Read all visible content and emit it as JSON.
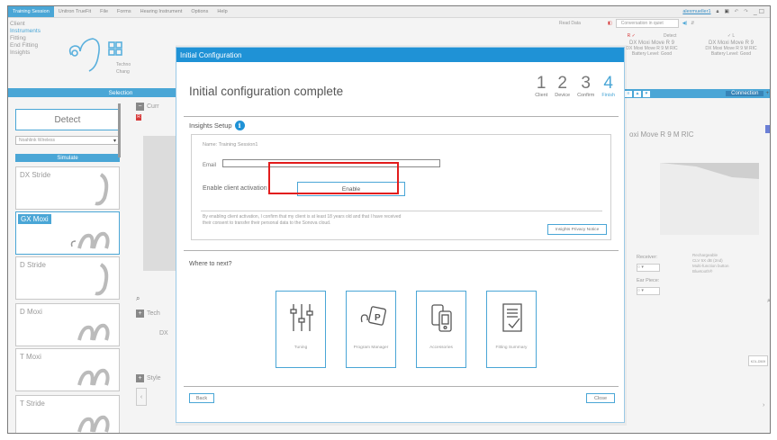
{
  "menubar": {
    "session": "Training Session",
    "items": [
      "Unitron TrueFit",
      "File",
      "Forms",
      "Hearing Instrument",
      "Options",
      "Help"
    ],
    "user": "alexmueller1",
    "win_controls": "_ ☐"
  },
  "leftnav": {
    "items": [
      "Client",
      "Instruments",
      "Fitting",
      "End Fitting",
      "Insights"
    ]
  },
  "workflow": {
    "label_1": "Techno",
    "label_2": "Chang"
  },
  "selection_label": "Selection",
  "left_panel": {
    "detect_label": "Detect",
    "wireless_option": "Noahlink Wireless",
    "simulate_label": "Simulate",
    "devices": [
      "DX Stride",
      "GX Moxi",
      "D Stride",
      "D Moxi",
      "T Moxi",
      "T Stride"
    ]
  },
  "center": {
    "cur_label": "Curr",
    "tech_label": "Tech",
    "dx_label": "DX",
    "style_label": "Style",
    "search_icon": "magnifier-icon"
  },
  "right_top": {
    "readcode": "Read Data",
    "conversation": "Conversation in quiet",
    "detect": "Detect",
    "left_device": "DX Moxi Move R 9",
    "right_device": "DX Moxi Move R 9",
    "left_sub": "DX Moxi Move R 9 M RIC",
    "right_sub": "DX Moxi Move R 9 M RIC",
    "left_battery": "Battery Level: Good",
    "right_battery": "Battery Level: Good",
    "connection": "Connection",
    "chart_title": "oxi Move R 9 M RIC",
    "receiver_label": "Receiver:",
    "earpiece_label": "Ear Piece:",
    "side_info": [
      "Rechargeable",
      "CLV 5X dB (2nd)",
      "Multi-function button",
      "Bluetooth®"
    ],
    "side_code": "KOL-D509"
  },
  "modal": {
    "title": "Initial Configuration",
    "heading": "Initial configuration complete",
    "steps": [
      {
        "num": "1",
        "label": "Client"
      },
      {
        "num": "2",
        "label": "Device"
      },
      {
        "num": "3",
        "label": "Confirm"
      },
      {
        "num": "4",
        "label": "Finish"
      }
    ],
    "insights_setup": "Insights Setup",
    "info_glyph": "i",
    "name_line": "Name:   Training Session1",
    "email_label": "Email",
    "email_value": "",
    "enable_label": "Enable client activation",
    "enable_button": "Enable",
    "consent_text": "By enabling client activation, I confirm that my client is at least 18 years old and that I have received their consent to transfer their personal data to the Sonova cloud.",
    "privacy_button": "Insights Privacy Notice",
    "where_next": "Where to next?",
    "tiles": [
      {
        "label": "Tuning",
        "icon": "sliders-icon"
      },
      {
        "label": "Program Manager",
        "icon": "program-manager-icon"
      },
      {
        "label": "Accessories",
        "icon": "accessories-icon"
      },
      {
        "label": "Fitting Summary",
        "icon": "fitting-summary-icon"
      }
    ],
    "back_button": "Back",
    "close_button": "Close"
  },
  "colors": {
    "accent": "#1f92d6",
    "light_accent": "#4aa6d6",
    "highlight": "#e21c1c"
  }
}
